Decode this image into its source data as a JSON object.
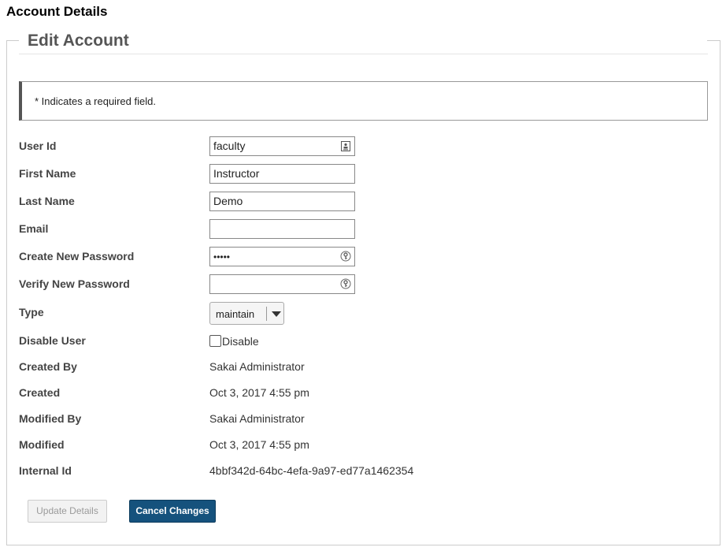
{
  "page": {
    "title": "Account Details"
  },
  "form": {
    "legend": "Edit Account",
    "required_notice": "* Indicates a required field.",
    "fields": {
      "user_id": {
        "label": "User Id",
        "value": "faculty",
        "icon": "contact-card-icon"
      },
      "first_name": {
        "label": "First Name",
        "value": "Instructor"
      },
      "last_name": {
        "label": "Last Name",
        "value": "Demo"
      },
      "email": {
        "label": "Email",
        "value": ""
      },
      "new_password": {
        "label": "Create New Password",
        "value": "•••••",
        "icon": "password-key-icon"
      },
      "verify_password": {
        "label": "Verify New Password",
        "value": "",
        "icon": "password-key-icon"
      },
      "type": {
        "label": "Type",
        "value": "maintain"
      },
      "disable_user": {
        "label": "Disable User",
        "checkbox_label": "Disable",
        "checked": false
      }
    },
    "info": {
      "created_by": {
        "label": "Created By",
        "value": "Sakai Administrator"
      },
      "created": {
        "label": "Created",
        "value": "Oct 3, 2017 4:55 pm"
      },
      "modified_by": {
        "label": "Modified By",
        "value": "Sakai Administrator"
      },
      "modified": {
        "label": "Modified",
        "value": "Oct 3, 2017 4:55 pm"
      },
      "internal_id": {
        "label": "Internal Id",
        "value": "4bbf342d-64bc-4efa-9a97-ed77a1462354"
      }
    },
    "buttons": {
      "update": "Update Details",
      "cancel": "Cancel Changes"
    }
  },
  "colors": {
    "primary_button": "#15527d",
    "disabled_button_text": "#9a9a9a",
    "notice_accent": "#555555"
  }
}
